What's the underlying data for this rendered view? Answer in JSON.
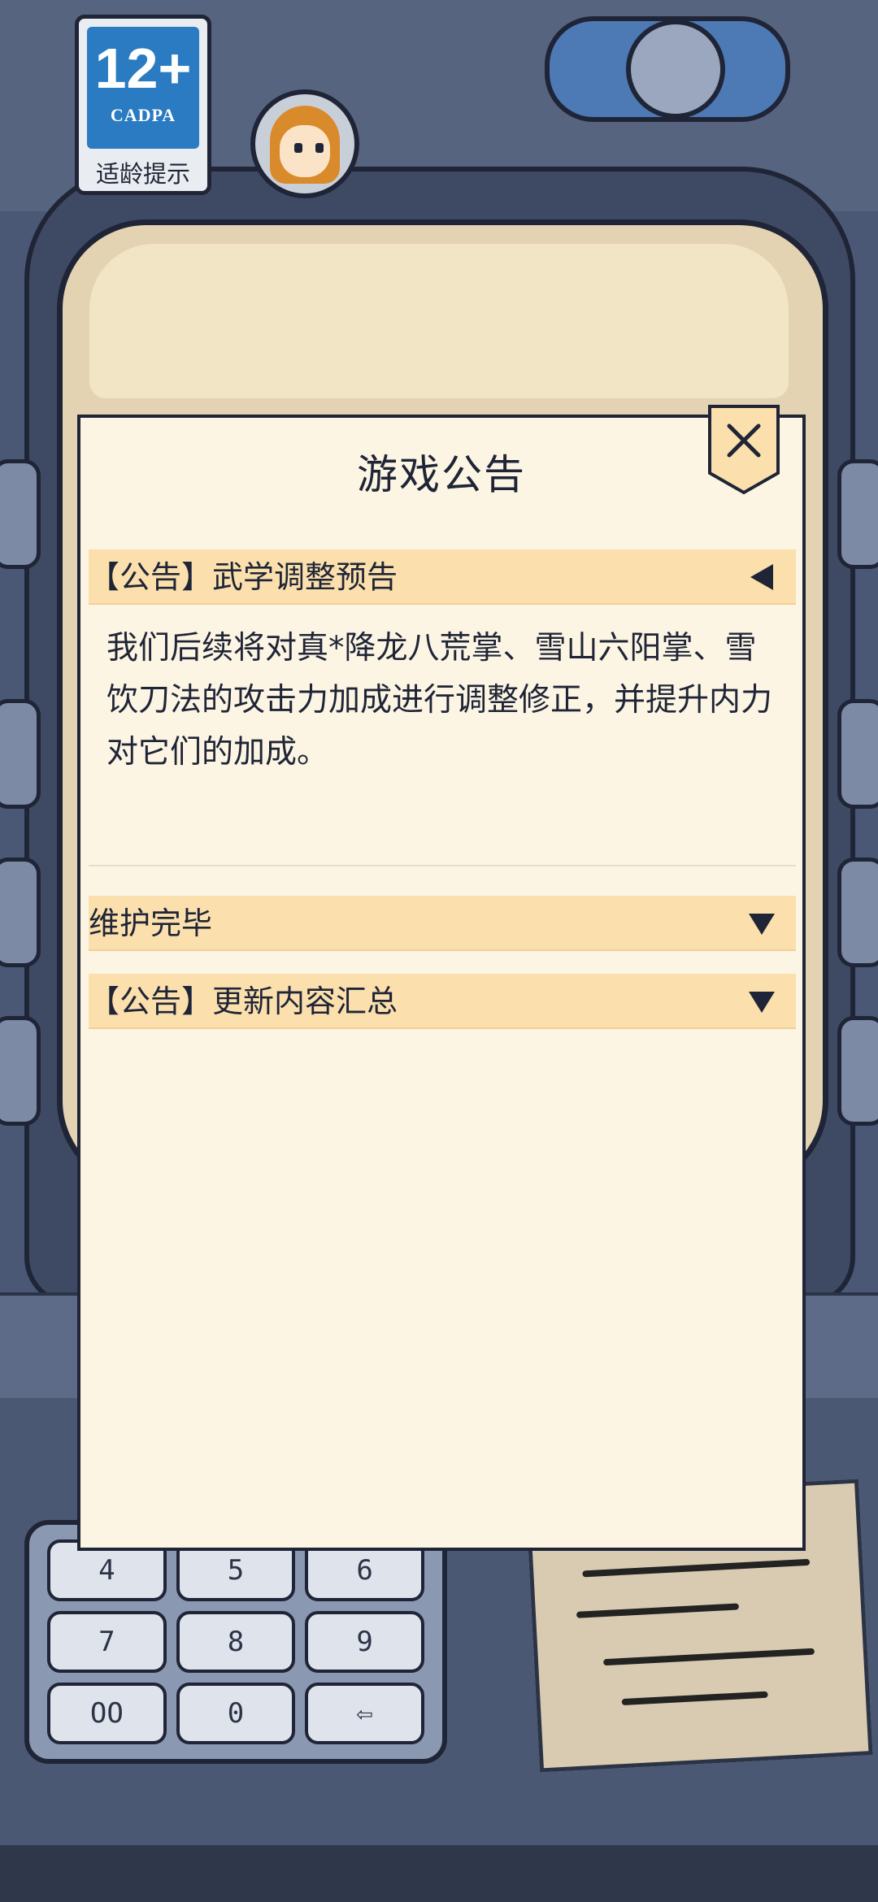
{
  "age_rating": {
    "number": "12+",
    "org": "CADPA",
    "label": "适龄提示"
  },
  "keypad": {
    "keys": [
      "4",
      "5",
      "6",
      "7",
      "8",
      "9",
      "OO",
      "0",
      "⇦"
    ]
  },
  "modal": {
    "title": "游戏公告",
    "close_icon": "close-icon",
    "sections": [
      {
        "title": "【公告】武学调整预告",
        "expanded": true,
        "arrow": "collapse-arrow-left-icon",
        "body": "我们后续将对真*降龙八荒掌、雪山六阳掌、雪饮刀法的攻击力加成进行调整修正，并提升内力对它们的加成。"
      },
      {
        "title": "维护完毕",
        "expanded": false,
        "arrow": "expand-arrow-down-icon"
      },
      {
        "title": "【公告】更新内容汇总",
        "expanded": false,
        "arrow": "expand-arrow-down-icon"
      }
    ]
  },
  "colors": {
    "panel_bg": "#fdf5e4",
    "section_header_bg": "#fbe0ad",
    "ink": "#1f2536",
    "age_badge_blue": "#2a7bc1"
  }
}
